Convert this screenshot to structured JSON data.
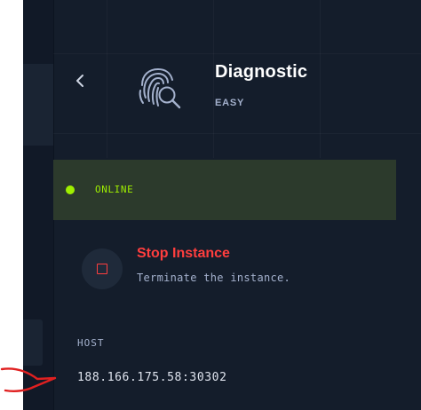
{
  "machine": {
    "name": "Diagnostic",
    "difficulty": "EASY",
    "icon": "fingerprint-search-icon"
  },
  "status": {
    "label": "ONLINE",
    "color": "#9fef00",
    "background": "#2c3a2c"
  },
  "actions": {
    "stop": {
      "title": "Stop Instance",
      "description": "Terminate the instance.",
      "color": "#ff3e3e",
      "icon": "stop-icon"
    }
  },
  "connection": {
    "host_label": "HOST",
    "host_value": "188.166.175.58:30302"
  },
  "colors": {
    "panel_background": "#141d2b",
    "accent_green": "#9fef00",
    "danger_red": "#ff3e3e",
    "muted_text": "#a4b1cd"
  }
}
